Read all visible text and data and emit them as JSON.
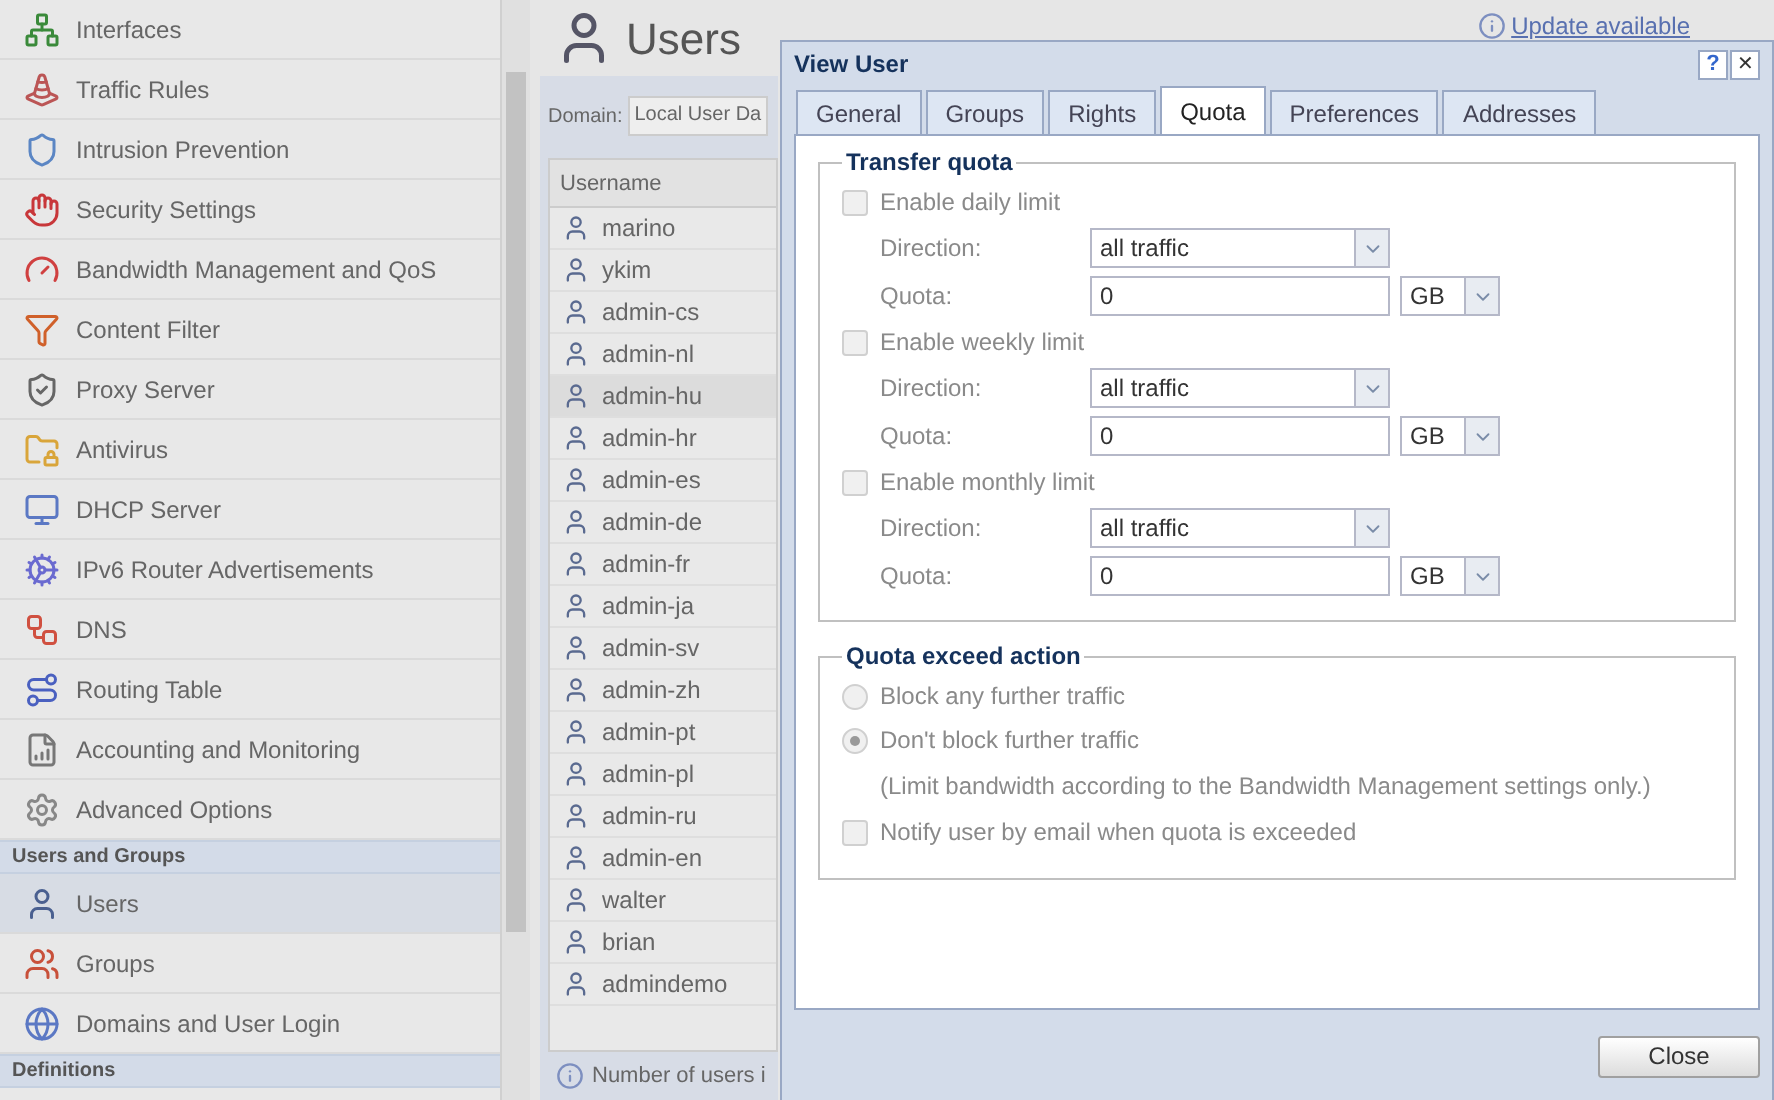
{
  "sidebar": {
    "items": [
      {
        "kind": "item",
        "label": "Interfaces",
        "selected": false
      },
      {
        "kind": "item",
        "label": "Traffic Rules",
        "selected": false
      },
      {
        "kind": "item",
        "label": "Intrusion Prevention",
        "selected": false
      },
      {
        "kind": "item",
        "label": "Security Settings",
        "selected": false
      },
      {
        "kind": "item",
        "label": "Bandwidth Management and QoS",
        "selected": false
      },
      {
        "kind": "item",
        "label": "Content Filter",
        "selected": false
      },
      {
        "kind": "item",
        "label": "Proxy Server",
        "selected": false
      },
      {
        "kind": "item",
        "label": "Antivirus",
        "selected": false
      },
      {
        "kind": "item",
        "label": "DHCP Server",
        "selected": false
      },
      {
        "kind": "item",
        "label": "IPv6 Router Advertisements",
        "selected": false
      },
      {
        "kind": "item",
        "label": "DNS",
        "selected": false
      },
      {
        "kind": "item",
        "label": "Routing Table",
        "selected": false
      },
      {
        "kind": "item",
        "label": "Accounting and Monitoring",
        "selected": false
      },
      {
        "kind": "item",
        "label": "Advanced Options",
        "selected": false
      },
      {
        "kind": "section",
        "label": "Users and Groups"
      },
      {
        "kind": "item",
        "label": "Users",
        "selected": true
      },
      {
        "kind": "item",
        "label": "Groups",
        "selected": false
      },
      {
        "kind": "item",
        "label": "Domains and User Login",
        "selected": false
      },
      {
        "kind": "section",
        "label": "Definitions"
      }
    ]
  },
  "page": {
    "title": "Users",
    "update_link": "Update available",
    "domain": {
      "label": "Domain:",
      "value": "Local User Da"
    },
    "table": {
      "columns": [
        "Username"
      ],
      "rows": [
        {
          "name": "marino",
          "selected": false
        },
        {
          "name": "ykim",
          "selected": false
        },
        {
          "name": "admin-cs",
          "selected": false
        },
        {
          "name": "admin-nl",
          "selected": false
        },
        {
          "name": "admin-hu",
          "selected": true
        },
        {
          "name": "admin-hr",
          "selected": false
        },
        {
          "name": "admin-es",
          "selected": false
        },
        {
          "name": "admin-de",
          "selected": false
        },
        {
          "name": "admin-fr",
          "selected": false
        },
        {
          "name": "admin-ja",
          "selected": false
        },
        {
          "name": "admin-sv",
          "selected": false
        },
        {
          "name": "admin-zh",
          "selected": false
        },
        {
          "name": "admin-pt",
          "selected": false
        },
        {
          "name": "admin-pl",
          "selected": false
        },
        {
          "name": "admin-ru",
          "selected": false
        },
        {
          "name": "admin-en",
          "selected": false
        },
        {
          "name": "walter",
          "selected": false
        },
        {
          "name": "brian",
          "selected": false
        },
        {
          "name": "admindemo",
          "selected": false
        }
      ]
    },
    "status": "Number of users i"
  },
  "dialog": {
    "title": "View User",
    "help": "?",
    "close_icon": "✕",
    "tabs": [
      {
        "label": "General",
        "selected": false
      },
      {
        "label": "Groups",
        "selected": false
      },
      {
        "label": "Rights",
        "selected": false
      },
      {
        "label": "Quota",
        "selected": true
      },
      {
        "label": "Preferences",
        "selected": false
      },
      {
        "label": "Addresses",
        "selected": false
      }
    ],
    "transfer_quota": {
      "title": "Transfer quota",
      "limits": [
        {
          "label": "Enable daily limit",
          "checked": false,
          "disabled": true,
          "direction_label": "Direction:",
          "direction": "all traffic",
          "quota_label": "Quota:",
          "quota": "0",
          "unit": "GB"
        },
        {
          "label": "Enable weekly limit",
          "checked": false,
          "disabled": true,
          "direction_label": "Direction:",
          "direction": "all traffic",
          "quota_label": "Quota:",
          "quota": "0",
          "unit": "GB"
        },
        {
          "label": "Enable monthly limit",
          "checked": false,
          "disabled": true,
          "direction_label": "Direction:",
          "direction": "all traffic",
          "quota_label": "Quota:",
          "quota": "0",
          "unit": "GB"
        }
      ]
    },
    "exceed_action": {
      "title": "Quota exceed action",
      "options": [
        {
          "kind": "radio",
          "label": "Block any further traffic",
          "selected": false,
          "disabled": true
        },
        {
          "kind": "radio",
          "label": "Don't block further traffic",
          "selected": true,
          "disabled": true
        },
        {
          "kind": "note",
          "label": "(Limit bandwidth according to the Bandwidth Management settings only.)"
        },
        {
          "kind": "checkbox",
          "label": "Notify user by email when quota is exceeded",
          "checked": false,
          "disabled": true
        }
      ]
    },
    "close_button": "Close"
  }
}
